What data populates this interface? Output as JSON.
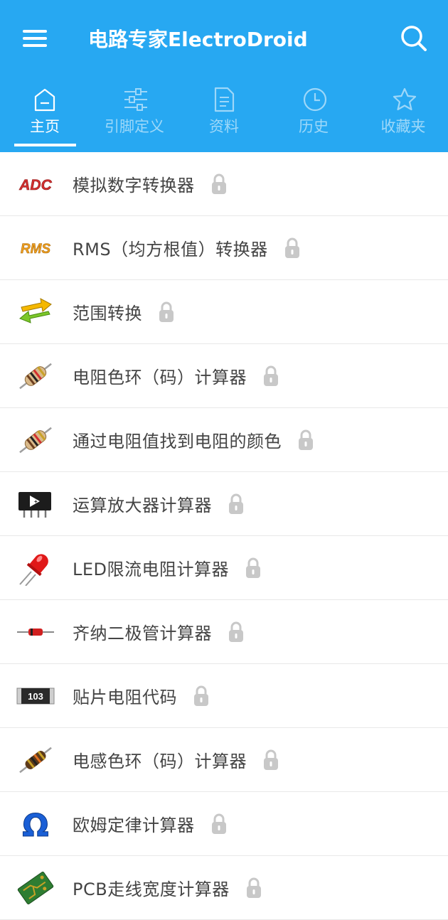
{
  "header": {
    "title": "电路专家ElectroDroid",
    "menu_icon": "hamburger-menu-icon",
    "search_icon": "search-icon",
    "background_color": "#27A8F2"
  },
  "tabs": [
    {
      "label": "主页",
      "icon": "home-icon",
      "active": true
    },
    {
      "label": "引脚定义",
      "icon": "sliders-icon",
      "active": false
    },
    {
      "label": "资料",
      "icon": "document-icon",
      "active": false
    },
    {
      "label": "历史",
      "icon": "clock-icon",
      "active": false
    },
    {
      "label": "收藏夹",
      "icon": "star-icon",
      "active": false
    }
  ],
  "items": [
    {
      "label": "模拟数字转换器",
      "icon": "adc-icon",
      "locked": true
    },
    {
      "label": "RMS（均方根值）转换器",
      "icon": "rms-icon",
      "locked": true
    },
    {
      "label": "范围转换",
      "icon": "range-arrows-icon",
      "locked": true
    },
    {
      "label": "电阻色环（码）计算器",
      "icon": "resistor-icon",
      "locked": true
    },
    {
      "label": "通过电阻值找到电阻的颜色",
      "icon": "resistor-icon",
      "locked": true
    },
    {
      "label": "运算放大器计算器",
      "icon": "op-amp-chip-icon",
      "locked": true
    },
    {
      "label": "LED限流电阻计算器",
      "icon": "led-icon",
      "locked": true
    },
    {
      "label": "齐纳二极管计算器",
      "icon": "zener-diode-icon",
      "locked": true
    },
    {
      "label": "贴片电阻代码",
      "icon": "smd-resistor-icon",
      "locked": true
    },
    {
      "label": "电感色环（码）计算器",
      "icon": "inductor-icon",
      "locked": true
    },
    {
      "label": "欧姆定律计算器",
      "icon": "ohm-icon",
      "locked": true
    },
    {
      "label": "PCB走线宽度计算器",
      "icon": "pcb-icon",
      "locked": true
    }
  ],
  "icon_texts": {
    "adc": "ADC",
    "rms": "RMS",
    "smd": "103",
    "ohm": "Ω"
  }
}
